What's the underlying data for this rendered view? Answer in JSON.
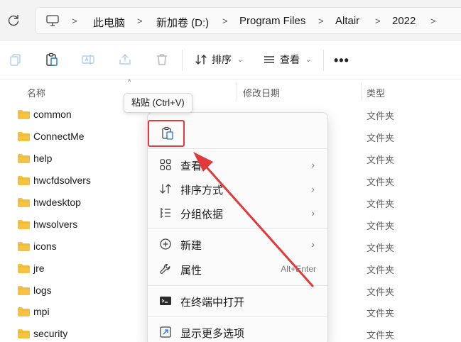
{
  "address": {
    "crumbs": [
      "此电脑",
      "新加卷 (D:)",
      "Program Files",
      "Altair",
      "2022"
    ]
  },
  "toolbar": {
    "sort_label": "排序",
    "view_label": "查看",
    "more_label": "•••"
  },
  "columns": {
    "name": "名称",
    "modified": "修改日期",
    "type": "类型"
  },
  "files": [
    {
      "name": "common",
      "type": "文件夹"
    },
    {
      "name": "ConnectMe",
      "type": "文件夹"
    },
    {
      "name": "help",
      "type": "文件夹"
    },
    {
      "name": "hwcfdsolvers",
      "type": "文件夹"
    },
    {
      "name": "hwdesktop",
      "type": "文件夹"
    },
    {
      "name": "hwsolvers",
      "type": "文件夹"
    },
    {
      "name": "icons",
      "type": "文件夹"
    },
    {
      "name": "jre",
      "type": "文件夹"
    },
    {
      "name": "logs",
      "type": "文件夹"
    },
    {
      "name": "mpi",
      "type": "文件夹"
    },
    {
      "name": "security",
      "type": "文件夹"
    }
  ],
  "tooltip": "粘贴 (Ctrl+V)",
  "context_menu": {
    "items": [
      {
        "label": "查看",
        "icon": "grid-icon"
      },
      {
        "label": "排序方式",
        "icon": "sort-icon"
      },
      {
        "label": "分组依据",
        "icon": "group-icon"
      },
      {
        "label": "新建",
        "icon": "plus-circle-icon"
      },
      {
        "label": "属性",
        "icon": "wrench-icon",
        "shortcut": "Alt+Enter"
      },
      {
        "label": "在终端中打开",
        "icon": "terminal-icon"
      },
      {
        "label": "显示更多选项",
        "icon": "expand-icon"
      }
    ]
  },
  "colors": {
    "highlight_box": "#e23a3a",
    "arrow": "#e23a3a",
    "folder": "#f5c242"
  }
}
